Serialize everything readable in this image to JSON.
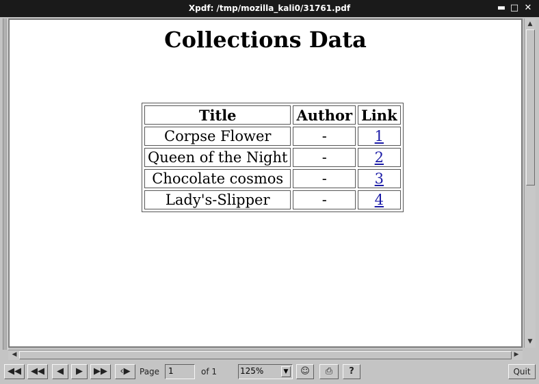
{
  "window": {
    "title": "Xpdf: /tmp/mozilla_kali0/31761.pdf"
  },
  "document": {
    "heading": "Collections Data",
    "table": {
      "headers": [
        "Title",
        "Author",
        "Link"
      ],
      "rows": [
        {
          "title": "Corpse Flower",
          "author": "-",
          "link": "1"
        },
        {
          "title": "Queen of the Night",
          "author": "-",
          "link": "2"
        },
        {
          "title": "Chocolate cosmos",
          "author": "-",
          "link": "3"
        },
        {
          "title": "Lady's-Slipper",
          "author": "-",
          "link": "4"
        }
      ]
    }
  },
  "toolbar": {
    "page_label": "Page",
    "page_value": "1",
    "page_total": "of 1",
    "zoom_value": "125%",
    "help_label": "?",
    "quit_label": "Quit"
  },
  "icons": {
    "first_page": "first-page-icon",
    "prev_5": "skip-back-icon",
    "prev": "prev-icon",
    "next": "next-icon",
    "next_5": "skip-forward-icon",
    "back": "history-back-icon",
    "find": "binoculars-icon",
    "print": "printer-icon"
  }
}
